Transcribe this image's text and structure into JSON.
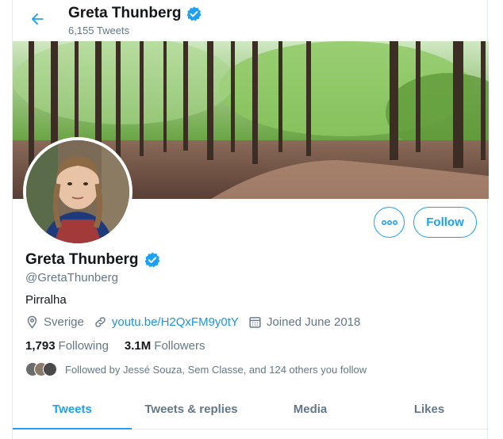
{
  "colors": {
    "accent": "#1da1f2",
    "link": "#1b95e0",
    "muted": "#657786",
    "text": "#14171a"
  },
  "header": {
    "back_icon": "arrow-left-icon",
    "name": "Greta Thunberg",
    "tweet_count": "6,155 Tweets"
  },
  "profile": {
    "name": "Greta Thunberg",
    "verified_icon": "verified-badge-icon",
    "handle": "@GretaThunberg",
    "bio": "Pirralha",
    "location": "Sverige",
    "website": "youtu.be/H2QxFM9y0tY",
    "joined": "Joined June 2018",
    "following_count": "1,793",
    "following_label": "Following",
    "followers_count": "3.1M",
    "followers_label": "Followers",
    "followed_by": "Followed by Jessé Souza, Sem Classe, and 124 others you follow"
  },
  "actions": {
    "more_icon": "more-icon",
    "follow_label": "Follow"
  },
  "tabs": [
    {
      "label": "Tweets",
      "active": true
    },
    {
      "label": "Tweets & replies",
      "active": false
    },
    {
      "label": "Media",
      "active": false
    },
    {
      "label": "Likes",
      "active": false
    }
  ]
}
